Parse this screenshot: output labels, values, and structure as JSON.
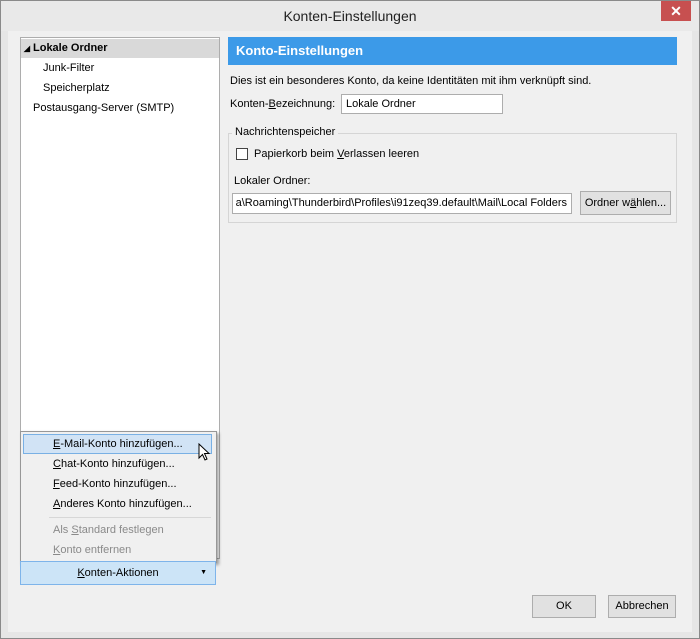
{
  "window": {
    "title": "Konten-Einstellungen",
    "close_glyph": "✕"
  },
  "tree": {
    "items": [
      {
        "label": "Lokale Ordner",
        "expand_glyph": "◢"
      },
      {
        "label": "Junk-Filter"
      },
      {
        "label": "Speicherplatz"
      },
      {
        "label": "Postausgang-Server (SMTP)"
      }
    ]
  },
  "panel": {
    "header": "Konto-Einstellungen",
    "info": "Dies ist ein besonderes Konto, da keine Identitäten mit ihm verknüpft sind.",
    "name_label_pre": "Konten-",
    "name_label_u": "B",
    "name_label_post": "ezeichnung:",
    "name_value": "Lokale Ordner",
    "storage_legend": "Nachrichtenspeicher",
    "empty_trash_pre": "Papierkorb beim ",
    "empty_trash_u": "V",
    "empty_trash_post": "erlassen leeren",
    "local_folder_label": "Lokaler Ordner:",
    "local_folder_value": "a\\Roaming\\Thunderbird\\Profiles\\i91zeq39.default\\Mail\\Local Folders",
    "choose_folder_pre": "Ordner w",
    "choose_folder_u": "ä",
    "choose_folder_post": "hlen..."
  },
  "menu": {
    "items": [
      {
        "pre": "",
        "u": "E",
        "post": "-Mail-Konto hinzufügen..."
      },
      {
        "pre": "",
        "u": "C",
        "post": "hat-Konto hinzufügen..."
      },
      {
        "pre": "",
        "u": "F",
        "post": "eed-Konto hinzufügen..."
      },
      {
        "pre": "",
        "u": "A",
        "post": "nderes Konto hinzufügen..."
      },
      {
        "pre": "Als ",
        "u": "S",
        "post": "tandard festlegen"
      },
      {
        "pre": "",
        "u": "K",
        "post": "onto entfernen"
      }
    ]
  },
  "actions_button": {
    "pre": "",
    "u": "K",
    "post": "onten-Aktionen",
    "caret": "▼"
  },
  "ok_button": "OK",
  "cancel_button": "Abbrechen",
  "colors": {
    "accent": "#3c9ae8",
    "menu_highlight": "#d1e3f5",
    "actions_bg": "#cce4f7",
    "close_red": "#c75050"
  }
}
